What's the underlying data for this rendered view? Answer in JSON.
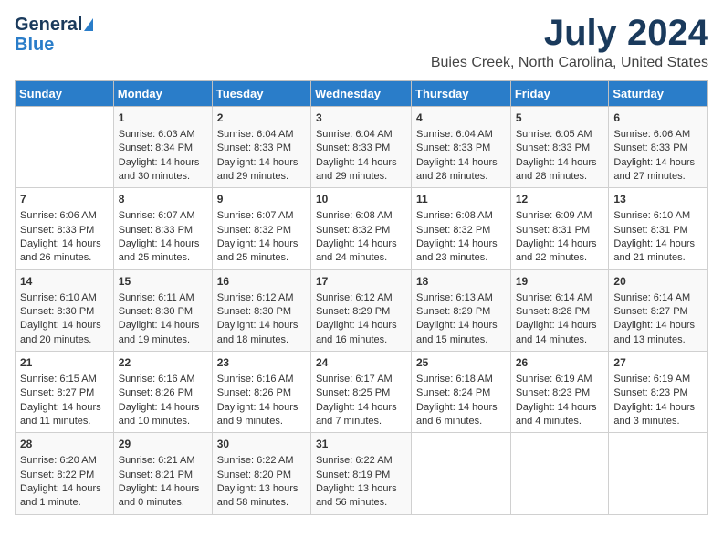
{
  "logo": {
    "general": "General",
    "blue": "Blue"
  },
  "title": {
    "month": "July 2024",
    "location": "Buies Creek, North Carolina, United States"
  },
  "weekdays": [
    "Sunday",
    "Monday",
    "Tuesday",
    "Wednesday",
    "Thursday",
    "Friday",
    "Saturday"
  ],
  "weeks": [
    [
      {
        "day": "",
        "text": ""
      },
      {
        "day": "1",
        "text": "Sunrise: 6:03 AM\nSunset: 8:34 PM\nDaylight: 14 hours\nand 30 minutes."
      },
      {
        "day": "2",
        "text": "Sunrise: 6:04 AM\nSunset: 8:33 PM\nDaylight: 14 hours\nand 29 minutes."
      },
      {
        "day": "3",
        "text": "Sunrise: 6:04 AM\nSunset: 8:33 PM\nDaylight: 14 hours\nand 29 minutes."
      },
      {
        "day": "4",
        "text": "Sunrise: 6:04 AM\nSunset: 8:33 PM\nDaylight: 14 hours\nand 28 minutes."
      },
      {
        "day": "5",
        "text": "Sunrise: 6:05 AM\nSunset: 8:33 PM\nDaylight: 14 hours\nand 28 minutes."
      },
      {
        "day": "6",
        "text": "Sunrise: 6:06 AM\nSunset: 8:33 PM\nDaylight: 14 hours\nand 27 minutes."
      }
    ],
    [
      {
        "day": "7",
        "text": "Sunrise: 6:06 AM\nSunset: 8:33 PM\nDaylight: 14 hours\nand 26 minutes."
      },
      {
        "day": "8",
        "text": "Sunrise: 6:07 AM\nSunset: 8:33 PM\nDaylight: 14 hours\nand 25 minutes."
      },
      {
        "day": "9",
        "text": "Sunrise: 6:07 AM\nSunset: 8:32 PM\nDaylight: 14 hours\nand 25 minutes."
      },
      {
        "day": "10",
        "text": "Sunrise: 6:08 AM\nSunset: 8:32 PM\nDaylight: 14 hours\nand 24 minutes."
      },
      {
        "day": "11",
        "text": "Sunrise: 6:08 AM\nSunset: 8:32 PM\nDaylight: 14 hours\nand 23 minutes."
      },
      {
        "day": "12",
        "text": "Sunrise: 6:09 AM\nSunset: 8:31 PM\nDaylight: 14 hours\nand 22 minutes."
      },
      {
        "day": "13",
        "text": "Sunrise: 6:10 AM\nSunset: 8:31 PM\nDaylight: 14 hours\nand 21 minutes."
      }
    ],
    [
      {
        "day": "14",
        "text": "Sunrise: 6:10 AM\nSunset: 8:30 PM\nDaylight: 14 hours\nand 20 minutes."
      },
      {
        "day": "15",
        "text": "Sunrise: 6:11 AM\nSunset: 8:30 PM\nDaylight: 14 hours\nand 19 minutes."
      },
      {
        "day": "16",
        "text": "Sunrise: 6:12 AM\nSunset: 8:30 PM\nDaylight: 14 hours\nand 18 minutes."
      },
      {
        "day": "17",
        "text": "Sunrise: 6:12 AM\nSunset: 8:29 PM\nDaylight: 14 hours\nand 16 minutes."
      },
      {
        "day": "18",
        "text": "Sunrise: 6:13 AM\nSunset: 8:29 PM\nDaylight: 14 hours\nand 15 minutes."
      },
      {
        "day": "19",
        "text": "Sunrise: 6:14 AM\nSunset: 8:28 PM\nDaylight: 14 hours\nand 14 minutes."
      },
      {
        "day": "20",
        "text": "Sunrise: 6:14 AM\nSunset: 8:27 PM\nDaylight: 14 hours\nand 13 minutes."
      }
    ],
    [
      {
        "day": "21",
        "text": "Sunrise: 6:15 AM\nSunset: 8:27 PM\nDaylight: 14 hours\nand 11 minutes."
      },
      {
        "day": "22",
        "text": "Sunrise: 6:16 AM\nSunset: 8:26 PM\nDaylight: 14 hours\nand 10 minutes."
      },
      {
        "day": "23",
        "text": "Sunrise: 6:16 AM\nSunset: 8:26 PM\nDaylight: 14 hours\nand 9 minutes."
      },
      {
        "day": "24",
        "text": "Sunrise: 6:17 AM\nSunset: 8:25 PM\nDaylight: 14 hours\nand 7 minutes."
      },
      {
        "day": "25",
        "text": "Sunrise: 6:18 AM\nSunset: 8:24 PM\nDaylight: 14 hours\nand 6 minutes."
      },
      {
        "day": "26",
        "text": "Sunrise: 6:19 AM\nSunset: 8:23 PM\nDaylight: 14 hours\nand 4 minutes."
      },
      {
        "day": "27",
        "text": "Sunrise: 6:19 AM\nSunset: 8:23 PM\nDaylight: 14 hours\nand 3 minutes."
      }
    ],
    [
      {
        "day": "28",
        "text": "Sunrise: 6:20 AM\nSunset: 8:22 PM\nDaylight: 14 hours\nand 1 minute."
      },
      {
        "day": "29",
        "text": "Sunrise: 6:21 AM\nSunset: 8:21 PM\nDaylight: 14 hours\nand 0 minutes."
      },
      {
        "day": "30",
        "text": "Sunrise: 6:22 AM\nSunset: 8:20 PM\nDaylight: 13 hours\nand 58 minutes."
      },
      {
        "day": "31",
        "text": "Sunrise: 6:22 AM\nSunset: 8:19 PM\nDaylight: 13 hours\nand 56 minutes."
      },
      {
        "day": "",
        "text": ""
      },
      {
        "day": "",
        "text": ""
      },
      {
        "day": "",
        "text": ""
      }
    ]
  ]
}
